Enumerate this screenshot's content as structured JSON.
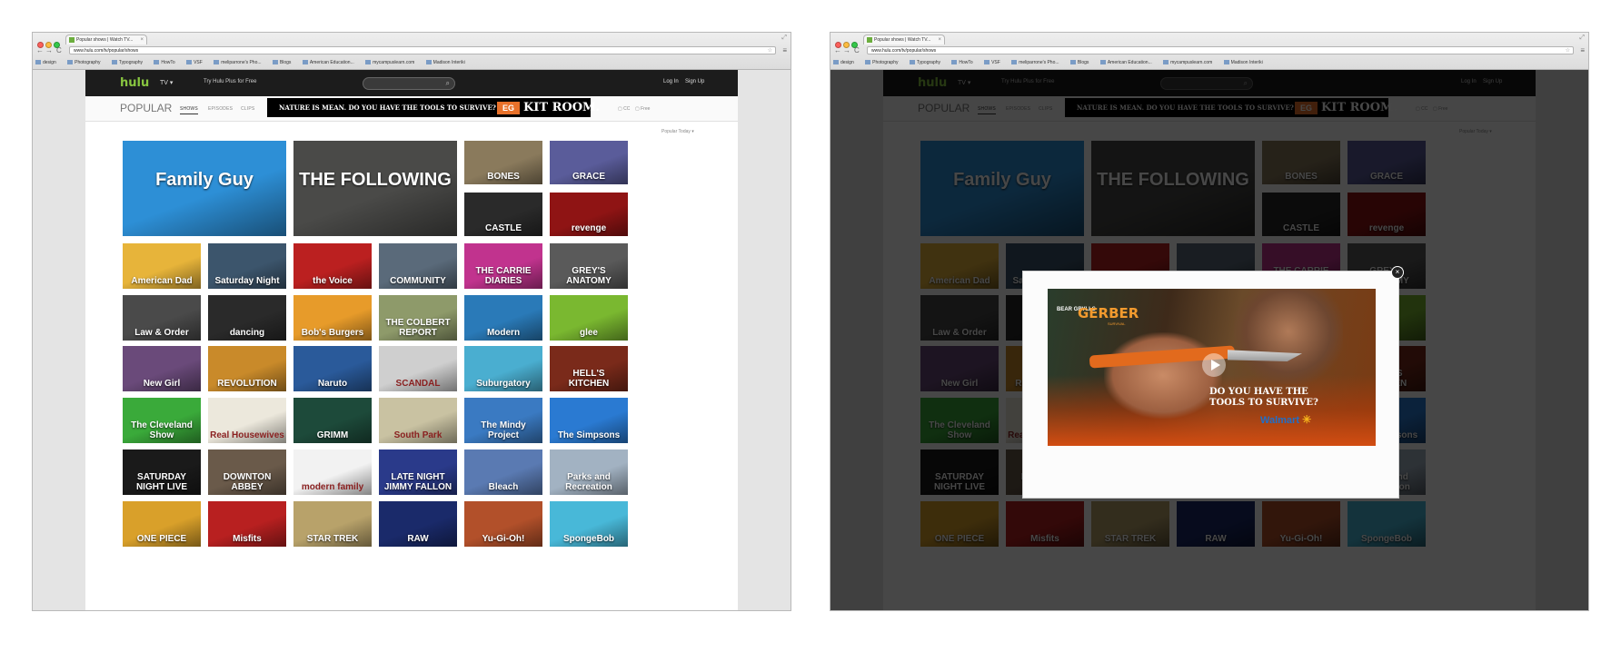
{
  "browser": {
    "tab_title": "Popular shows | Watch TV...",
    "tab_close": "×",
    "url": "www.hulu.com/tv/popular/shows",
    "bookmarks": [
      "design",
      "Photography",
      "Typography",
      "HowTo",
      "VSF",
      "meliparrone's Pho...",
      "Blogs",
      "American Education...",
      "mycampuslearn.com",
      "Madison Interiki"
    ],
    "back": "←",
    "forward": "→",
    "reload": "C",
    "menu": "≡",
    "star": "☆"
  },
  "header": {
    "logo": "hulu",
    "tv_menu": "TV ▾",
    "try_plus": "Try Hulu Plus for Free",
    "search_icon": "⌕",
    "login": "Log In",
    "signup": "Sign Up"
  },
  "subnav": {
    "title": "POPULAR",
    "tabs": [
      "SHOWS",
      "EPISODES",
      "CLIPS"
    ],
    "filter_cc": "CC",
    "filter_free": "Free",
    "sort": "Popular Today ▾"
  },
  "banner_ad": {
    "text": "NATURE IS MEAN. DO YOU HAVE THE TOOLS TO SURVIVE?",
    "logo": "EG",
    "brand": "KIT ROOM."
  },
  "shows": [
    {
      "title": "Family Guy",
      "color": "#2d8fd6",
      "big": true
    },
    {
      "title": "THE FOLLOWING",
      "color": "#4a4a48",
      "big": true
    },
    {
      "title": "BONES",
      "color": "#8a7a5c"
    },
    {
      "title": "GRACE",
      "color": "#5a5c9a"
    },
    {
      "title": "CASTLE",
      "color": "#2a2a2a"
    },
    {
      "title": "revenge",
      "color": "#8f1414"
    },
    {
      "title": "American Dad",
      "color": "#e7b43a"
    },
    {
      "title": "Saturday Night",
      "color": "#3c556c"
    },
    {
      "title": "the Voice",
      "color": "#bb2020"
    },
    {
      "title": "COMMUNITY",
      "color": "#5a6a7a"
    },
    {
      "title": "THE CARRIE DIARIES",
      "color": "#c1338e"
    },
    {
      "title": "GREY'S ANATOMY",
      "color": "#5a5a5a"
    },
    {
      "title": "Law & Order",
      "color": "#4a4a4a"
    },
    {
      "title": "dancing",
      "color": "#2a2a2a"
    },
    {
      "title": "Bob's Burgers",
      "color": "#e79b2a"
    },
    {
      "title": "THE COLBERT REPORT",
      "color": "#8e9a6a"
    },
    {
      "title": "Modern",
      "color": "#2a7ab8"
    },
    {
      "title": "glee",
      "color": "#7ab830"
    },
    {
      "title": "New Girl",
      "color": "#6a4a7a"
    },
    {
      "title": "REVOLUTION",
      "color": "#c98a2a"
    },
    {
      "title": "Naruto",
      "color": "#2a5a9a"
    },
    {
      "title": "SCANDAL",
      "color": "#cfcfcf"
    },
    {
      "title": "Suburgatory",
      "color": "#4aaed0"
    },
    {
      "title": "HELL'S KITCHEN",
      "color": "#7a2a1a"
    },
    {
      "title": "The Cleveland Show",
      "color": "#3aaa3a"
    },
    {
      "title": "Real Housewives",
      "color": "#ece8dc"
    },
    {
      "title": "GRIMM",
      "color": "#1d4a3a"
    },
    {
      "title": "South Park",
      "color": "#c9c2a2"
    },
    {
      "title": "The Mindy Project",
      "color": "#3a7ac2"
    },
    {
      "title": "The Simpsons",
      "color": "#2a7ad2"
    },
    {
      "title": "SATURDAY NIGHT LIVE",
      "color": "#1a1a1a"
    },
    {
      "title": "DOWNTON ABBEY",
      "color": "#6a5a4a"
    },
    {
      "title": "modern family",
      "color": "#f2f2f2"
    },
    {
      "title": "LATE NIGHT JIMMY FALLON",
      "color": "#2a3a8a"
    },
    {
      "title": "Bleach",
      "color": "#5a7ab2"
    },
    {
      "title": "Parks and Recreation",
      "color": "#a2b2c2"
    },
    {
      "title": "ONE PIECE",
      "color": "#d9a02a"
    },
    {
      "title": "Misfits",
      "color": "#b82020"
    },
    {
      "title": "STAR TREK",
      "color": "#b8a26a"
    },
    {
      "title": "RAW",
      "color": "#1a2a6a"
    },
    {
      "title": "Yu-Gi-Oh!",
      "color": "#b2502a"
    },
    {
      "title": "SpongeBob",
      "color": "#48b8d8"
    }
  ],
  "modal": {
    "close": "×",
    "brand_bear": "BEAR GRYLLS",
    "brand_gerber": "GERBER",
    "brand_sub": "SURVIVAL",
    "headline_1": "DO YOU HAVE THE",
    "headline_2": "TOOLS TO SURVIVE?",
    "retailer": "Walmart",
    "retailer_spark": "✳"
  }
}
